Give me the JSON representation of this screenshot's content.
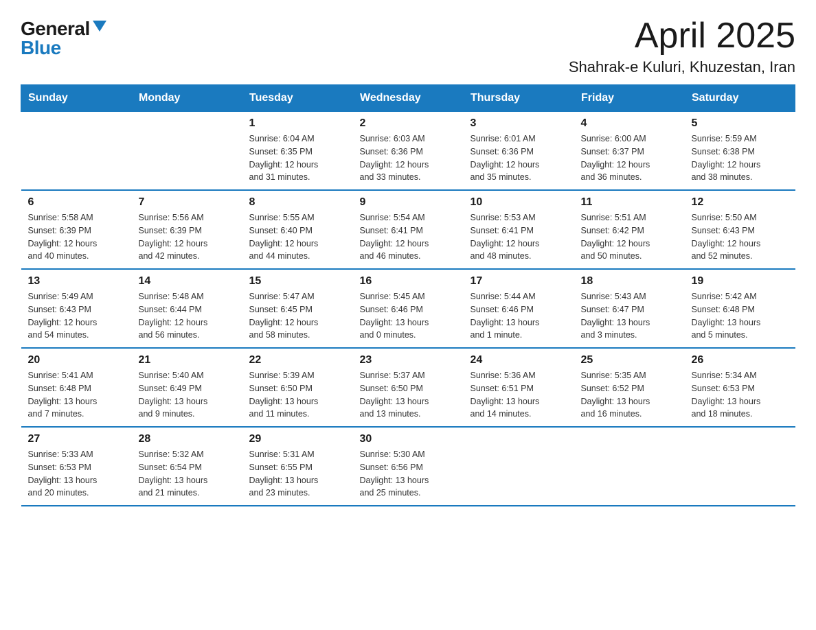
{
  "logo": {
    "general": "General",
    "blue": "Blue"
  },
  "title": "April 2025",
  "location": "Shahrak-e Kuluri, Khuzestan, Iran",
  "weekdays": [
    "Sunday",
    "Monday",
    "Tuesday",
    "Wednesday",
    "Thursday",
    "Friday",
    "Saturday"
  ],
  "weeks": [
    [
      {
        "day": "",
        "info": []
      },
      {
        "day": "",
        "info": []
      },
      {
        "day": "1",
        "info": [
          "Sunrise: 6:04 AM",
          "Sunset: 6:35 PM",
          "Daylight: 12 hours",
          "and 31 minutes."
        ]
      },
      {
        "day": "2",
        "info": [
          "Sunrise: 6:03 AM",
          "Sunset: 6:36 PM",
          "Daylight: 12 hours",
          "and 33 minutes."
        ]
      },
      {
        "day": "3",
        "info": [
          "Sunrise: 6:01 AM",
          "Sunset: 6:36 PM",
          "Daylight: 12 hours",
          "and 35 minutes."
        ]
      },
      {
        "day": "4",
        "info": [
          "Sunrise: 6:00 AM",
          "Sunset: 6:37 PM",
          "Daylight: 12 hours",
          "and 36 minutes."
        ]
      },
      {
        "day": "5",
        "info": [
          "Sunrise: 5:59 AM",
          "Sunset: 6:38 PM",
          "Daylight: 12 hours",
          "and 38 minutes."
        ]
      }
    ],
    [
      {
        "day": "6",
        "info": [
          "Sunrise: 5:58 AM",
          "Sunset: 6:39 PM",
          "Daylight: 12 hours",
          "and 40 minutes."
        ]
      },
      {
        "day": "7",
        "info": [
          "Sunrise: 5:56 AM",
          "Sunset: 6:39 PM",
          "Daylight: 12 hours",
          "and 42 minutes."
        ]
      },
      {
        "day": "8",
        "info": [
          "Sunrise: 5:55 AM",
          "Sunset: 6:40 PM",
          "Daylight: 12 hours",
          "and 44 minutes."
        ]
      },
      {
        "day": "9",
        "info": [
          "Sunrise: 5:54 AM",
          "Sunset: 6:41 PM",
          "Daylight: 12 hours",
          "and 46 minutes."
        ]
      },
      {
        "day": "10",
        "info": [
          "Sunrise: 5:53 AM",
          "Sunset: 6:41 PM",
          "Daylight: 12 hours",
          "and 48 minutes."
        ]
      },
      {
        "day": "11",
        "info": [
          "Sunrise: 5:51 AM",
          "Sunset: 6:42 PM",
          "Daylight: 12 hours",
          "and 50 minutes."
        ]
      },
      {
        "day": "12",
        "info": [
          "Sunrise: 5:50 AM",
          "Sunset: 6:43 PM",
          "Daylight: 12 hours",
          "and 52 minutes."
        ]
      }
    ],
    [
      {
        "day": "13",
        "info": [
          "Sunrise: 5:49 AM",
          "Sunset: 6:43 PM",
          "Daylight: 12 hours",
          "and 54 minutes."
        ]
      },
      {
        "day": "14",
        "info": [
          "Sunrise: 5:48 AM",
          "Sunset: 6:44 PM",
          "Daylight: 12 hours",
          "and 56 minutes."
        ]
      },
      {
        "day": "15",
        "info": [
          "Sunrise: 5:47 AM",
          "Sunset: 6:45 PM",
          "Daylight: 12 hours",
          "and 58 minutes."
        ]
      },
      {
        "day": "16",
        "info": [
          "Sunrise: 5:45 AM",
          "Sunset: 6:46 PM",
          "Daylight: 13 hours",
          "and 0 minutes."
        ]
      },
      {
        "day": "17",
        "info": [
          "Sunrise: 5:44 AM",
          "Sunset: 6:46 PM",
          "Daylight: 13 hours",
          "and 1 minute."
        ]
      },
      {
        "day": "18",
        "info": [
          "Sunrise: 5:43 AM",
          "Sunset: 6:47 PM",
          "Daylight: 13 hours",
          "and 3 minutes."
        ]
      },
      {
        "day": "19",
        "info": [
          "Sunrise: 5:42 AM",
          "Sunset: 6:48 PM",
          "Daylight: 13 hours",
          "and 5 minutes."
        ]
      }
    ],
    [
      {
        "day": "20",
        "info": [
          "Sunrise: 5:41 AM",
          "Sunset: 6:48 PM",
          "Daylight: 13 hours",
          "and 7 minutes."
        ]
      },
      {
        "day": "21",
        "info": [
          "Sunrise: 5:40 AM",
          "Sunset: 6:49 PM",
          "Daylight: 13 hours",
          "and 9 minutes."
        ]
      },
      {
        "day": "22",
        "info": [
          "Sunrise: 5:39 AM",
          "Sunset: 6:50 PM",
          "Daylight: 13 hours",
          "and 11 minutes."
        ]
      },
      {
        "day": "23",
        "info": [
          "Sunrise: 5:37 AM",
          "Sunset: 6:50 PM",
          "Daylight: 13 hours",
          "and 13 minutes."
        ]
      },
      {
        "day": "24",
        "info": [
          "Sunrise: 5:36 AM",
          "Sunset: 6:51 PM",
          "Daylight: 13 hours",
          "and 14 minutes."
        ]
      },
      {
        "day": "25",
        "info": [
          "Sunrise: 5:35 AM",
          "Sunset: 6:52 PM",
          "Daylight: 13 hours",
          "and 16 minutes."
        ]
      },
      {
        "day": "26",
        "info": [
          "Sunrise: 5:34 AM",
          "Sunset: 6:53 PM",
          "Daylight: 13 hours",
          "and 18 minutes."
        ]
      }
    ],
    [
      {
        "day": "27",
        "info": [
          "Sunrise: 5:33 AM",
          "Sunset: 6:53 PM",
          "Daylight: 13 hours",
          "and 20 minutes."
        ]
      },
      {
        "day": "28",
        "info": [
          "Sunrise: 5:32 AM",
          "Sunset: 6:54 PM",
          "Daylight: 13 hours",
          "and 21 minutes."
        ]
      },
      {
        "day": "29",
        "info": [
          "Sunrise: 5:31 AM",
          "Sunset: 6:55 PM",
          "Daylight: 13 hours",
          "and 23 minutes."
        ]
      },
      {
        "day": "30",
        "info": [
          "Sunrise: 5:30 AM",
          "Sunset: 6:56 PM",
          "Daylight: 13 hours",
          "and 25 minutes."
        ]
      },
      {
        "day": "",
        "info": []
      },
      {
        "day": "",
        "info": []
      },
      {
        "day": "",
        "info": []
      }
    ]
  ]
}
